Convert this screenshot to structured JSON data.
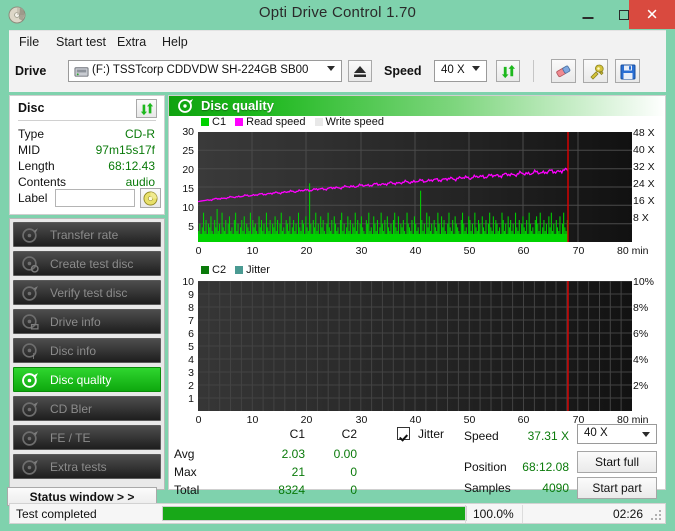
{
  "window": {
    "title": "Opti Drive Control 1.70",
    "app_icon": "disc-icon",
    "minimize": "minimize-icon",
    "maximize": "maximize-icon",
    "close": "✕"
  },
  "menu": [
    {
      "label": "File"
    },
    {
      "label": "Start test"
    },
    {
      "label": "Extra"
    },
    {
      "label": "Help"
    }
  ],
  "toolbar": {
    "drive_label": "Drive",
    "drive_value": "(F:)  TSSTcorp CDDVDW SH-224GB SB00",
    "eject_icon": "eject-icon",
    "speed_label": "Speed",
    "speed_value": "40 X",
    "refresh_icon": "refresh-arrows-icon",
    "erase_icon": "eraser-icon",
    "tools_icon": "wrench-icon",
    "save_icon": "floppy-save-icon"
  },
  "disc": {
    "title": "Disc",
    "refresh_icon": "refresh-arrows-icon",
    "rows": [
      {
        "key": "Type",
        "value": "CD-R"
      },
      {
        "key": "MID",
        "value": "97m15s17f"
      },
      {
        "key": "Length",
        "value": "68:12.43"
      },
      {
        "key": "Contents",
        "value": "audio"
      }
    ],
    "label_key": "Label",
    "label_value": "",
    "label_placeholder": "",
    "label_button_icon": "cd-disc-icon"
  },
  "sidebar": {
    "items": [
      {
        "label": "Transfer rate",
        "icon": "disc-test-icon",
        "active": false
      },
      {
        "label": "Create test disc",
        "icon": "disc-burn-icon",
        "active": false
      },
      {
        "label": "Verify test disc",
        "icon": "disc-verify-icon",
        "active": false
      },
      {
        "label": "Drive info",
        "icon": "drive-info-icon",
        "active": false
      },
      {
        "label": "Disc info",
        "icon": "disc-info-icon",
        "active": false
      },
      {
        "label": "Disc quality",
        "icon": "disc-quality-icon",
        "active": true
      },
      {
        "label": "CD Bler",
        "icon": "disc-bler-icon",
        "active": false
      },
      {
        "label": "FE / TE",
        "icon": "disc-fete-icon",
        "active": false
      },
      {
        "label": "Extra tests",
        "icon": "disc-extra-icon",
        "active": false
      }
    ],
    "status_window": "Status window > >"
  },
  "main": {
    "header_title": "Disc quality",
    "header_icon": "disc-quality-icon"
  },
  "stats": {
    "col_headers": [
      "C1",
      "C2"
    ],
    "rows": [
      {
        "label": "Avg",
        "c1": "2.03",
        "c2": "0.00"
      },
      {
        "label": "Max",
        "c1": "21",
        "c2": "0"
      },
      {
        "label": "Total",
        "c1": "8324",
        "c2": "0"
      }
    ],
    "jitter_label": "Jitter",
    "jitter_checked": true,
    "speed_label": "Speed",
    "speed_value": "37.31 X",
    "position_label": "Position",
    "position_value": "68:12.08",
    "samples_label": "Samples",
    "samples_value": "4090",
    "speed_select": "40 X",
    "start_full": "Start full",
    "start_part": "Start part"
  },
  "statusbar": {
    "text": "Test completed",
    "progress_percent": "100.0%",
    "progress_value": 100,
    "elapsed": "02:26",
    "grip_icon": "resize-grip-icon"
  },
  "colors": {
    "accent_green": "#0ea80e",
    "c1_green": "#00d200",
    "read_speed_magenta": "#ff00ff",
    "write_speed_gray": "#e8e8e8",
    "c2_green": "#0a7a0a",
    "jitter_teal": "#4a9a92",
    "marker_red": "#e00000",
    "title_bar": "#7fd2ad",
    "close_button": "#d94a3f",
    "value_text": "#0a7a0a"
  },
  "chart_data": [
    {
      "type": "area",
      "name": "quality-chart-top",
      "title": "",
      "xlabel": "80 min",
      "ylabel": "",
      "xlim": [
        0,
        80
      ],
      "ylim": [
        0,
        30
      ],
      "y2lim": [
        0,
        52
      ],
      "y2label": "X",
      "grid": true,
      "legend": [
        "C1",
        "Read speed",
        "Write speed"
      ],
      "legend_colors": [
        "#00d200",
        "#ff00ff",
        "#e8e8e8"
      ],
      "xticks": [
        0,
        10,
        20,
        30,
        40,
        50,
        60,
        70,
        80
      ],
      "yticks": [
        5,
        10,
        15,
        20,
        25,
        30
      ],
      "y2ticks": [
        "8 X",
        "16 X",
        "24 X",
        "32 X",
        "40 X",
        "48 X"
      ],
      "data_end_x": 68.2,
      "marker_x": 68.2,
      "marker_color": "#e00000",
      "series": [
        {
          "name": "C1",
          "color": "#00d200",
          "type": "bar",
          "x_start": 0,
          "x_end": 68.2,
          "values": [
            3,
            5,
            2,
            4,
            8,
            3,
            6,
            2,
            5,
            4,
            7,
            3,
            2,
            6,
            4,
            9,
            3,
            5,
            2,
            8,
            4,
            3,
            6,
            2,
            5,
            7,
            3,
            4,
            2,
            6,
            8,
            3,
            5,
            2,
            4,
            6,
            3,
            7,
            2,
            5,
            4,
            3,
            8,
            2,
            6,
            4,
            5,
            3,
            2,
            7,
            4,
            6,
            3,
            5,
            2,
            8,
            4,
            3,
            6,
            2,
            5,
            4,
            7,
            3,
            6,
            2,
            5,
            8,
            3,
            4,
            2,
            6,
            5,
            3,
            7,
            2,
            4,
            6,
            3,
            5,
            2,
            8,
            4,
            3,
            6,
            5,
            2,
            7,
            4,
            3,
            16,
            5,
            2,
            6,
            4,
            8,
            3,
            5,
            2,
            7,
            4,
            6,
            3,
            2,
            5,
            8,
            4,
            3,
            6,
            2,
            7,
            5,
            3,
            4,
            2,
            6,
            8,
            3,
            5,
            2,
            4,
            7,
            3,
            6,
            2,
            5,
            4,
            8,
            3,
            6,
            2,
            5,
            7,
            4,
            3,
            2,
            6,
            5,
            8,
            3,
            4,
            2,
            7,
            5,
            3,
            6,
            2,
            4,
            8,
            5,
            3,
            6,
            2,
            7,
            4,
            3,
            5,
            2,
            6,
            8,
            4,
            3,
            7,
            2,
            5,
            4,
            6,
            3,
            2,
            8,
            5,
            4,
            3,
            6,
            2,
            7,
            5,
            3,
            4,
            2,
            14,
            6,
            3,
            5,
            2,
            8,
            4,
            7,
            3,
            5,
            2,
            6,
            4,
            3,
            8,
            5,
            2,
            7,
            4,
            6,
            3,
            2,
            5,
            8,
            4,
            3,
            6,
            2,
            7,
            5,
            4,
            3,
            2,
            6,
            8,
            5,
            3,
            4,
            2,
            7,
            6,
            3,
            5,
            2,
            8,
            4,
            3,
            6,
            5,
            2,
            7,
            4,
            3,
            6,
            2,
            5,
            8,
            4,
            3,
            7,
            2,
            6,
            5,
            3,
            4,
            2,
            8,
            6,
            3,
            5,
            2,
            7,
            4,
            6,
            3,
            5,
            2,
            8,
            4,
            3,
            6,
            2,
            5,
            7,
            4,
            3,
            6,
            2,
            8,
            5,
            3,
            4,
            2,
            6,
            7,
            5,
            3,
            8,
            2,
            4,
            6,
            3,
            5,
            2,
            7,
            4,
            8,
            3,
            5,
            2,
            6,
            4,
            3,
            7,
            2,
            5,
            8,
            4,
            3,
            6
          ]
        },
        {
          "name": "Read speed",
          "color": "#ff00ff",
          "type": "line",
          "x_start": 0,
          "x_end": 68.2,
          "y_axis": "right",
          "start_value": 11,
          "end_value": 19.5,
          "description": "Rising read-speed curve from ~11 X at 0 min to ~19.5 X at 68 min"
        },
        {
          "name": "Write speed",
          "color": "#e8e8e8",
          "type": "line",
          "values": []
        }
      ]
    },
    {
      "type": "area",
      "name": "quality-chart-bottom",
      "title": "",
      "xlabel": "80 min",
      "ylabel": "",
      "xlim": [
        0,
        80
      ],
      "ylim": [
        0,
        10
      ],
      "y2lim": [
        0,
        10
      ],
      "y2label": "%",
      "grid": true,
      "legend": [
        "C2",
        "Jitter"
      ],
      "legend_colors": [
        "#0a7a0a",
        "#4a9a92"
      ],
      "xticks": [
        0,
        10,
        20,
        30,
        40,
        50,
        60,
        70,
        80
      ],
      "yticks": [
        1,
        2,
        3,
        4,
        5,
        6,
        7,
        8,
        9,
        10
      ],
      "y2ticks": [
        "2%",
        "4%",
        "6%",
        "8%",
        "10%"
      ],
      "data_end_x": 68.2,
      "marker_x": 68.2,
      "marker_color": "#e00000",
      "series": [
        {
          "name": "C2",
          "color": "#0a7a0a",
          "type": "bar",
          "values": []
        },
        {
          "name": "Jitter",
          "color": "#4a9a92",
          "type": "line",
          "values": []
        }
      ]
    }
  ]
}
